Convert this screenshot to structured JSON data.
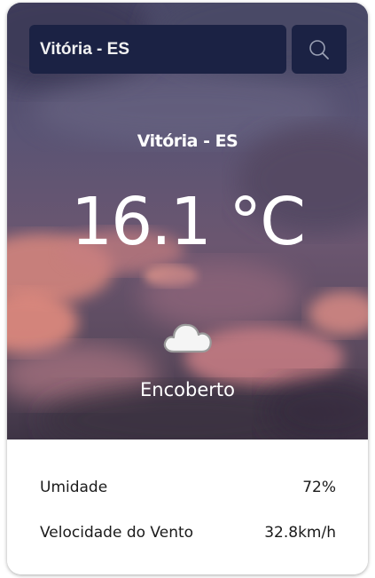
{
  "search": {
    "value": "Vitória - ES",
    "button_icon": "search-icon"
  },
  "weather": {
    "city": "Vitória - ES",
    "temperature": "16.1 °C",
    "description": "Encoberto",
    "icon": "cloud-icon"
  },
  "details": {
    "humidity_label": "Umidade",
    "humidity_value": "72%",
    "wind_label": "Velocidade do Vento",
    "wind_value": "32.8km/h"
  },
  "colors": {
    "input_bg": "#1b2244",
    "text_light": "#ffffff",
    "text_dark": "#1a1a1a"
  }
}
